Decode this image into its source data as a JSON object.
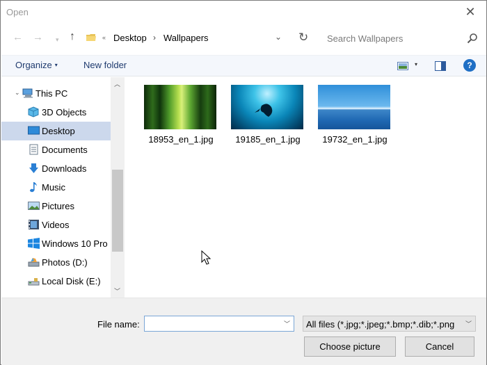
{
  "window": {
    "title": "Open"
  },
  "titlebar": {
    "close_glyph": "✕"
  },
  "address": {
    "crumbs": [
      "Desktop",
      "Wallpapers"
    ],
    "separator": "›",
    "search_placeholder": "Search Wallpapers"
  },
  "toolbar": {
    "organize_label": "Organize",
    "new_folder_label": "New folder",
    "help_label": "?"
  },
  "nav": {
    "items": [
      {
        "label": "This PC",
        "icon": "computer-icon"
      },
      {
        "label": "3D Objects",
        "icon": "cube-icon"
      },
      {
        "label": "Desktop",
        "icon": "desktop-icon",
        "selected": true
      },
      {
        "label": "Documents",
        "icon": "documents-icon"
      },
      {
        "label": "Downloads",
        "icon": "download-arrow-icon"
      },
      {
        "label": "Music",
        "icon": "music-note-icon"
      },
      {
        "label": "Pictures",
        "icon": "pictures-icon"
      },
      {
        "label": "Videos",
        "icon": "videos-icon"
      },
      {
        "label": "Windows 10 Pro",
        "icon": "windows-logo-icon"
      },
      {
        "label": "Photos (D:)",
        "icon": "drive-icon"
      },
      {
        "label": "Local Disk (E:)",
        "icon": "usb-drive-icon"
      }
    ]
  },
  "files": [
    {
      "name": "18953_en_1.jpg",
      "thumb": "bamboo-forest"
    },
    {
      "name": "19185_en_1.jpg",
      "thumb": "ocean-diver"
    },
    {
      "name": "19732_en_1.jpg",
      "thumb": "open-sea"
    }
  ],
  "footer": {
    "file_name_label": "File name:",
    "file_name_value": "",
    "file_type_value": "All files (*.jpg;*.jpeg;*.bmp;*.dib;*.png",
    "choose_label": "Choose picture",
    "cancel_label": "Cancel"
  },
  "colors": {
    "accent": "#1f6fc5",
    "selection": "#ccd8ec",
    "command_text": "#1e3a6e"
  }
}
